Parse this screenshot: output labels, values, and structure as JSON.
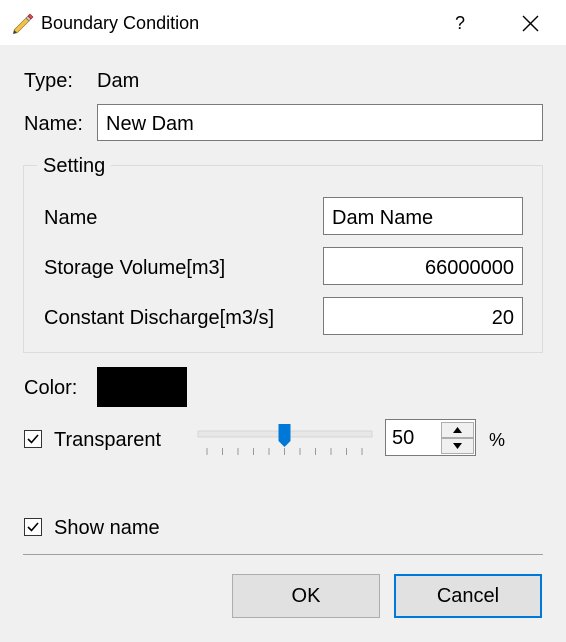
{
  "window": {
    "title": "Boundary Condition",
    "help_label": "?"
  },
  "form": {
    "type_label": "Type:",
    "type_value": "Dam",
    "name_label": "Name:",
    "name_value": "New Dam"
  },
  "setting": {
    "title": "Setting",
    "dam_name_label": "Name",
    "dam_name_value": "Dam Name",
    "storage_label": "Storage Volume[m3]",
    "storage_value": "66000000",
    "discharge_label": "Constant Discharge[m3/s]",
    "discharge_value": "20"
  },
  "appearance": {
    "color_label": "Color:",
    "color_value": "#000000",
    "transparent_label": "Transparent",
    "transparent_checked": true,
    "opacity_value": "50",
    "opacity_unit": "%",
    "slider_fraction": 0.5,
    "show_name_label": "Show name",
    "show_name_checked": true
  },
  "buttons": {
    "ok": "OK",
    "cancel": "Cancel"
  },
  "colors": {
    "accent": "#0078d7",
    "titlebar": "#ffffff",
    "background": "#f0f0f0"
  },
  "icons": {
    "title": "pencil-icon",
    "close": "close-icon",
    "check": "checkmark-icon"
  }
}
